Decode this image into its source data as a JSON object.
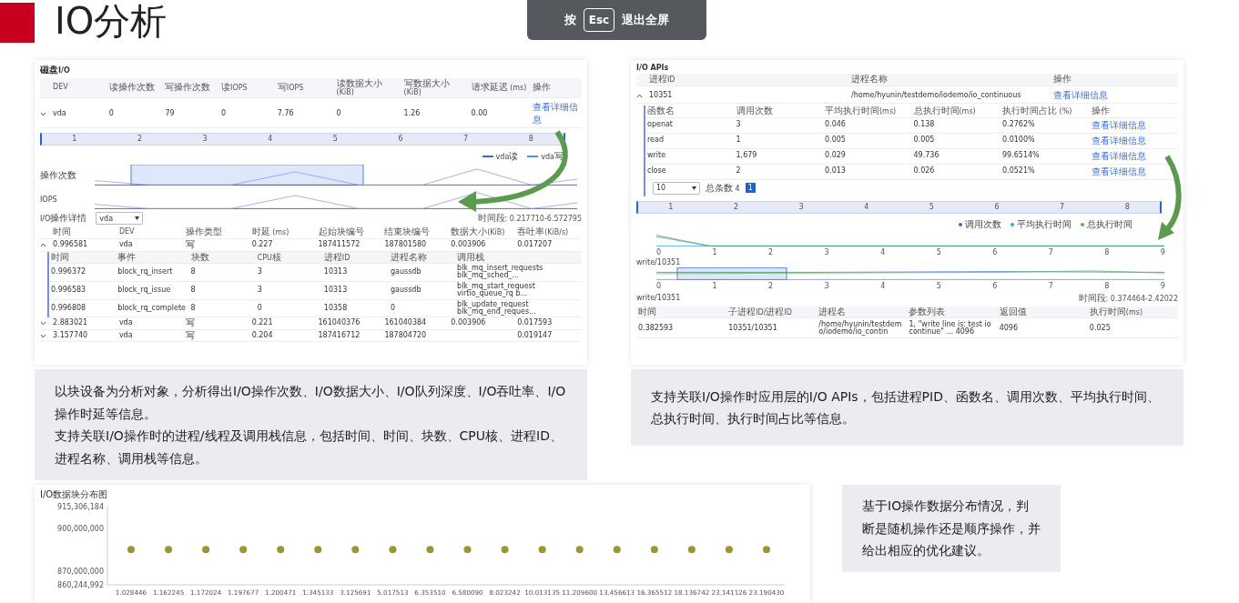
{
  "slide": {
    "title": "IO分析"
  },
  "fullscreen_hint": {
    "before": "按",
    "key": "Esc",
    "after": "退出全屏"
  },
  "disk_io_panel": {
    "title": "磁盘I/O",
    "columns": [
      "DEV",
      "读操作次数",
      "写操作次数",
      "读IOPS",
      "写IOPS",
      "读数据大小 (KiB)",
      "写数据大小 (KiB)",
      "请求延迟 (ms)",
      "操作"
    ],
    "rows": [
      {
        "expanded": false,
        "cells": [
          "vda",
          "0",
          "79",
          "0",
          "7.76",
          "0",
          "1.26",
          "0.00"
        ],
        "action": "查看详细信息"
      }
    ],
    "timeline_ticks": [
      "1",
      "2",
      "3",
      "4",
      "5",
      "6",
      "7",
      "8"
    ],
    "legend": [
      {
        "label": "vda读",
        "color": "#2f6fd6"
      },
      {
        "label": "vda写",
        "color": "#5b8be8"
      }
    ],
    "charts": [
      {
        "label": "操作次数"
      },
      {
        "label": "IOPS"
      }
    ],
    "detail": {
      "title": "I/O操作详情",
      "select": "vda",
      "range": "时间段: 0.217710-6.572795",
      "columns": [
        "时间",
        "DEV",
        "操作类型",
        "时延 (ms)",
        "起始块编号",
        "结束块编号",
        "数据大小(KiB)",
        "吞吐率(KiB/s)"
      ],
      "rows": [
        {
          "expanded": true,
          "cells": [
            "0.996581",
            "vda",
            "写",
            "0.227",
            "187411572",
            "187801580",
            "0.003906",
            "0.017207"
          ],
          "subtable": {
            "columns": [
              "时间",
              "事件",
              "块数",
              "CPU核",
              "进程ID",
              "进程名称",
              "调用栈"
            ],
            "rows": [
              [
                "0.996372",
                "block_rq_insert",
                "8",
                "3",
                "10313",
                "gaussdb",
                "blk_mq_insert_requests blk_mq_sched_..."
              ],
              [
                "0.996583",
                "block_rq_issue",
                "8",
                "3",
                "10313",
                "gaussdb",
                "blk_mq_start_request virtio_queue_rq b..."
              ],
              [
                "0.996808",
                "block_rq_complete",
                "8",
                "0",
                "10358",
                "0",
                "blk_update_request blk_mq_end_reques..."
              ]
            ]
          }
        },
        {
          "expanded": false,
          "cells": [
            "2.883021",
            "vda",
            "写",
            "0.221",
            "161040376",
            "161040384",
            "0.003906",
            "0.017593"
          ]
        },
        {
          "expanded": false,
          "cells": [
            "3.157740",
            "vda",
            "写",
            "0.204",
            "187416712",
            "187804720",
            "",
            "0.019147"
          ]
        }
      ]
    }
  },
  "disk_io_caption": [
    "以块设备为分析对象，分析得出I/O操作次数、I/O数据大小、I/O队列深度、I/O吞吐率、I/O操作时延等信息。",
    "支持关联I/O操作时的进程/线程及调用栈信息，包括时间、时间、块数、CPU核、进程ID、进程名称、调用栈等信息。"
  ],
  "io_apis_panel": {
    "title": "I/O APIs",
    "columns": [
      "进程ID",
      "进程名称",
      "操作"
    ],
    "rows": [
      {
        "expanded": true,
        "cells": [
          "10351",
          "/home/hyunin/testdemo/iodemo/io_continuous"
        ],
        "action": "查看详细信息",
        "subtable": {
          "columns": [
            "函数名",
            "调用次数",
            "平均执行时间(ms)",
            "总执行时间(ms)",
            "执行时间占比 (%)",
            "操作"
          ],
          "rows": [
            {
              "cells": [
                "openat",
                "3",
                "0.046",
                "0.138",
                "0.2762%"
              ],
              "action": "查看详细信息"
            },
            {
              "cells": [
                "read",
                "1",
                "0.005",
                "0.005",
                "0.0100%"
              ],
              "action": "查看详细信息"
            },
            {
              "cells": [
                "write",
                "1,679",
                "0.029",
                "49.736",
                "99.6514%"
              ],
              "action": "查看详细信息"
            },
            {
              "cells": [
                "close",
                "2",
                "0.013",
                "0.026",
                "0.0521%"
              ],
              "action": "查看详细信息"
            }
          ]
        },
        "pagination": {
          "page_size": "10",
          "total": "总条数 4",
          "pages": [
            {
              "label": "1",
              "selected": true
            }
          ]
        }
      }
    ],
    "timeline_ticks": [
      "1",
      "2",
      "3",
      "4",
      "5",
      "6",
      "7",
      "8"
    ],
    "legend": [
      {
        "label": "调用次数",
        "color": "#2f6fd6"
      },
      {
        "label": "平均执行时间",
        "color": "#3aa6d8"
      },
      {
        "label": "总执行时间",
        "color": "#5ab552"
      }
    ],
    "charts": [
      {
        "x_ticks": [
          "0",
          "1",
          "2",
          "3",
          "4",
          "5",
          "6",
          "7",
          "8",
          "9"
        ]
      },
      {
        "title": "write/10351",
        "x_ticks": [
          "0",
          "1",
          "2",
          "3",
          "4",
          "5",
          "6",
          "7",
          "8",
          "9"
        ]
      }
    ],
    "detail": {
      "title": "write/10351",
      "range": "时间段: 0.374464-2.42022",
      "columns": [
        "时间",
        "子进程ID/进程ID",
        "进程名",
        "参数列表",
        "返回值",
        "执行时间(ms)"
      ],
      "rows": [
        [
          "0.382593",
          "10351/10351",
          "/home/hyunin/testdemo/iodemo/io_contin",
          "1, \"write line is: test io continue\" ... 4096",
          "4096",
          "0.025"
        ]
      ]
    }
  },
  "io_apis_caption": [
    "支持关联I/O操作时应用层的I/O APIs，包括进程PID、函数名、调用次数、平均执行时间、总执行时间、执行时间占比等信息。"
  ],
  "block_chart": {
    "title": "I/O数据块分布图",
    "chart_data": {
      "type": "scatter",
      "categories": [
        "1.028446",
        "1.162245",
        "1.172024",
        "1.197677",
        "1.200471",
        "1.345133",
        "3.125691",
        "5.017513",
        "6.353510",
        "6.580090",
        "8.023242",
        "10.013135",
        "11.209600",
        "13.456613",
        "16.365512",
        "18.136742",
        "23.141126",
        "23.190430"
      ],
      "values": [
        885000000,
        885000000,
        885000000,
        885000000,
        885000000,
        885000000,
        885000000,
        885000000,
        885000000,
        885000000,
        885000000,
        885000000,
        885000000,
        885000000,
        885000000,
        885000000,
        885000000,
        885000000
      ],
      "ylim": [
        860244992,
        915306184
      ],
      "yticks": [
        {
          "value": 860244992,
          "label": "860,244,992"
        },
        {
          "value": 870000000,
          "label": "870,000,000"
        },
        {
          "value": 900000000,
          "label": "900,000,000"
        },
        {
          "value": 915306184,
          "label": "915,306,184"
        }
      ]
    }
  },
  "block_caption": [
    "基于IO操作数据分布情况，判断是随机操作还是顺序操作，并给出相应的优化建议。"
  ]
}
